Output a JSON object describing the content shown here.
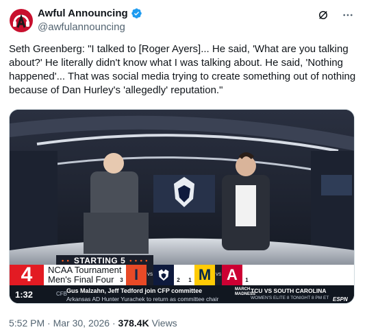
{
  "author": {
    "display_name": "Awful Announcing",
    "handle": "@awfulannouncing",
    "verified": true,
    "avatar_icon": "awful-announcing-logo-icon",
    "avatar_color": "#c8102e"
  },
  "actions": {
    "grok_icon": "grok-icon",
    "more_icon": "more-options-icon"
  },
  "tweet": {
    "text": "Seth Greenberg: \"I talked to [Roger Ayers]... He said, 'What are you talking about?' He literally didn't know what I was talking about. He said, 'Nothing happened'... That was social media trying to create something out of nothing because of Dan Hurley's 'allegedly' reputation.\""
  },
  "video_overlay": {
    "graphic_title": "STARTING 5",
    "rank_number": "4",
    "event_line1": "NCAA Tournament",
    "event_line2": "Men's Final Four",
    "matchups": [
      {
        "team": "I",
        "seed": "3"
      },
      {
        "team": "UConn",
        "seed": "2"
      },
      {
        "team": "M",
        "seed": "1"
      },
      {
        "team": "A",
        "seed": "1"
      }
    ],
    "vs_label": "VS",
    "ticker": {
      "clock": "1:32",
      "category": "CFB",
      "headline": "Gus Malzahn, Jeff Tedford join CFP committee",
      "subheadline": "Arkansas AD Hunter Yurachek to return as committee chair",
      "event_tag": "MARCH MADNESS",
      "game_line": "TCU VS SOUTH CAROLINA",
      "game_detail": "WOMEN'S ELITE 8  TONIGHT 8 PM ET",
      "network": "ESPN"
    }
  },
  "meta": {
    "time": "5:52 PM",
    "date": "Mar 30, 2026",
    "views_count": "378.4K",
    "views_label": "Views"
  },
  "colors": {
    "accent_blue": "#1d9bf0",
    "text_secondary": "#536471",
    "espn_red": "#e31b23"
  }
}
